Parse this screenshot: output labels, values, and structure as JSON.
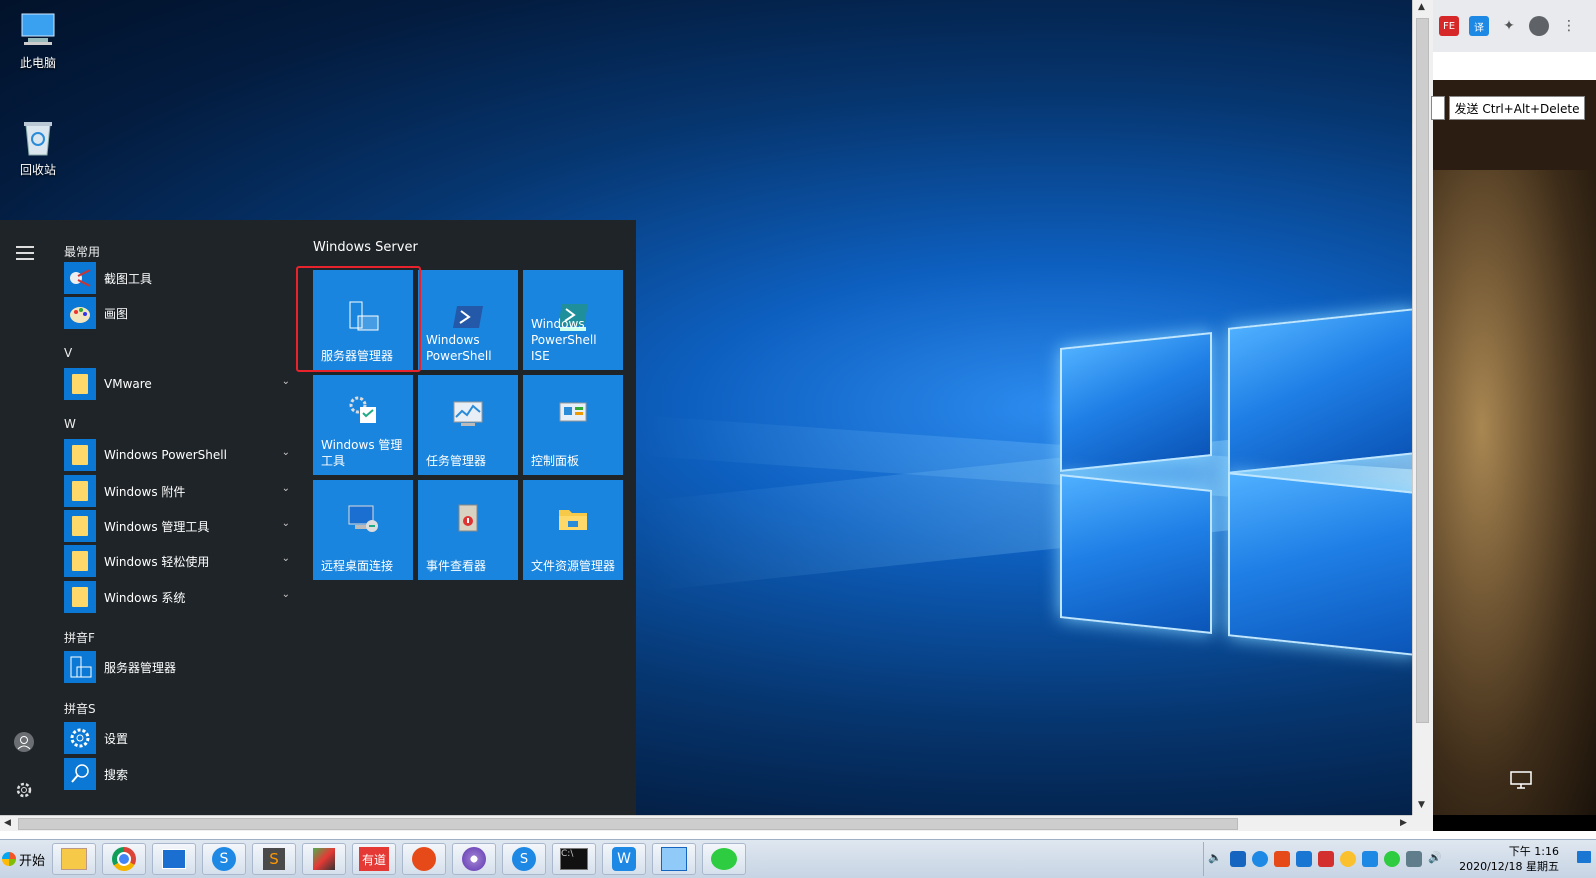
{
  "desktop": {
    "icons": [
      {
        "label": "此电脑",
        "icon": "computer-icon"
      },
      {
        "label": "回收站",
        "icon": "recycle-bin-icon"
      }
    ]
  },
  "start_menu": {
    "most_used_header": "最常用",
    "most_used": [
      {
        "label": "截图工具",
        "icon": "snipping-tool-icon"
      },
      {
        "label": "画图",
        "icon": "paint-icon"
      }
    ],
    "sections": [
      {
        "letter": "V",
        "items": [
          {
            "label": "VMware",
            "expandable": true
          }
        ]
      },
      {
        "letter": "W",
        "items": [
          {
            "label": "Windows PowerShell",
            "expandable": true
          },
          {
            "label": "Windows 附件",
            "expandable": true
          },
          {
            "label": "Windows 管理工具",
            "expandable": true
          },
          {
            "label": "Windows 轻松使用",
            "expandable": true
          },
          {
            "label": "Windows 系统",
            "expandable": true
          }
        ]
      },
      {
        "letter": "拼音F",
        "items": [
          {
            "label": "服务器管理器",
            "expandable": false
          }
        ]
      },
      {
        "letter": "拼音S",
        "items": [
          {
            "label": "设置",
            "expandable": false
          },
          {
            "label": "搜索",
            "expandable": false
          }
        ]
      }
    ],
    "tiles_header": "Windows Server",
    "tiles": [
      {
        "label": "服务器管理器",
        "icon": "server-manager-icon",
        "highlighted": true
      },
      {
        "label": "Windows PowerShell",
        "icon": "powershell-icon"
      },
      {
        "label": "Windows PowerShell ISE",
        "icon": "powershell-ise-icon"
      },
      {
        "label": "Windows 管理工具",
        "icon": "admin-tools-icon"
      },
      {
        "label": "任务管理器",
        "icon": "task-manager-icon"
      },
      {
        "label": "控制面板",
        "icon": "control-panel-icon"
      },
      {
        "label": "远程桌面连接",
        "icon": "remote-desktop-icon"
      },
      {
        "label": "事件查看器",
        "icon": "event-viewer-icon"
      },
      {
        "label": "文件资源管理器",
        "icon": "file-explorer-icon"
      }
    ],
    "highlight_color": "#e8232b"
  },
  "browser": {
    "extension_icons": [
      "FE",
      "译"
    ],
    "send_cad_label": "发送 Ctrl+Alt+Delete"
  },
  "taskbar": {
    "start_label": "开始",
    "apps": [
      "file-manager-icon",
      "chrome-icon",
      "remote-desktop-icon",
      "sogou-icon",
      "sublime-icon",
      "vmware-icon",
      "youdao-icon",
      "snail-icon",
      "media-player-icon",
      "sogou-download-icon",
      "cmd-icon",
      "wps-icon",
      "network-monitor-icon",
      "wechat-icon"
    ],
    "youdao_text": "有道",
    "clock_ampm_time": "下午 1:16",
    "clock_date": "2020/12/18 星期五"
  },
  "colors": {
    "tile": "#1a85de",
    "start_bg": "#1f2428",
    "accent": "#0a78d4"
  }
}
